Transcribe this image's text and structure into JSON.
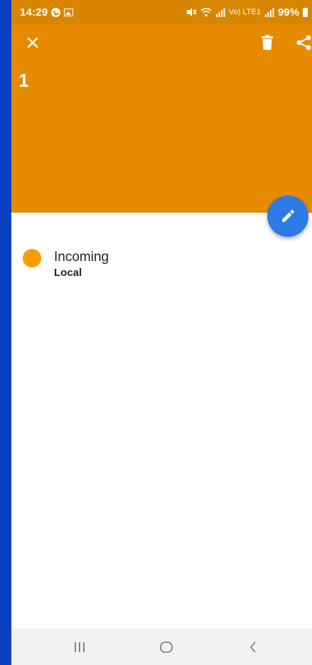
{
  "status_bar": {
    "time": "14:29",
    "signal_text": "Vo) LTE1",
    "battery_percent": "99%"
  },
  "header": {
    "title": "1",
    "background_color": "#e68a00"
  },
  "icons": {
    "close": "close-icon",
    "delete": "trash-icon",
    "share": "share-icon",
    "edit": "pencil-icon"
  },
  "entry": {
    "title": "Incoming",
    "subtitle": "Local",
    "dot_color": "#ff9900"
  },
  "colors": {
    "fab": "#2d7be5",
    "frame": "#0a3fbf"
  }
}
